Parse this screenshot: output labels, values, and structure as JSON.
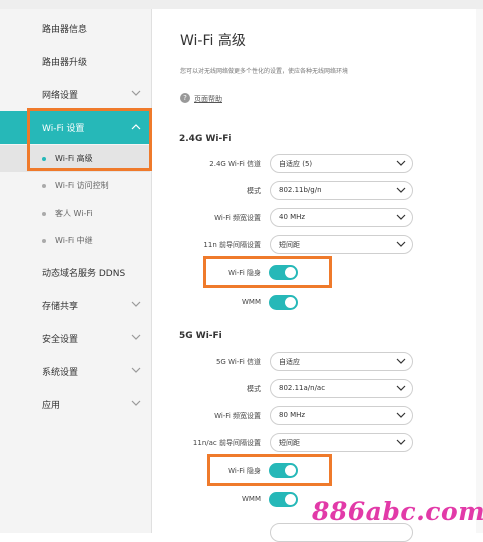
{
  "sidebar": {
    "items": [
      {
        "label": "路由器信息"
      },
      {
        "label": "路由器升级"
      },
      {
        "label": "网络设置"
      },
      {
        "label": "Wi-Fi 设置"
      },
      {
        "label": "动态域名服务 DDNS"
      },
      {
        "label": "存储共享"
      },
      {
        "label": "安全设置"
      },
      {
        "label": "系统设置"
      },
      {
        "label": "应用"
      }
    ],
    "subitems": [
      {
        "label": "Wi-Fi 高级"
      },
      {
        "label": "Wi-Fi 访问控制"
      },
      {
        "label": "客人 Wi-Fi"
      },
      {
        "label": "Wi-Fi 中继"
      }
    ]
  },
  "main": {
    "title": "Wi-Fi 高级",
    "description": "您可以对无线网络做更多个性化的设置，使应各种无线网络环境",
    "help": "页面帮助",
    "band24": {
      "heading": "2.4G Wi-Fi",
      "channel": {
        "label": "2.4G Wi-Fi 信道",
        "value": "自适应 (5)"
      },
      "mode": {
        "label": "模式",
        "value": "802.11b/g/n"
      },
      "bandwidth": {
        "label": "Wi-Fi 频宽设置",
        "value": "40 MHz"
      },
      "guard": {
        "label": "11n 前导间隔设置",
        "value": "短间距"
      },
      "hide": {
        "label": "Wi-Fi 隐身",
        "on": true
      },
      "wmm": {
        "label": "WMM",
        "on": true
      }
    },
    "band5": {
      "heading": "5G Wi-Fi",
      "channel": {
        "label": "5G Wi-Fi 信道",
        "value": "自适应"
      },
      "mode": {
        "label": "模式",
        "value": "802.11a/n/ac"
      },
      "bandwidth": {
        "label": "Wi-Fi 频宽设置",
        "value": "80 MHz"
      },
      "guard": {
        "label": "11n/ac 前导间隔设置",
        "value": "短间距"
      },
      "hide": {
        "label": "Wi-Fi 隐身",
        "on": true
      },
      "wmm": {
        "label": "WMM",
        "on": true
      }
    }
  },
  "watermark": "886abc.com",
  "colors": {
    "accent": "#26b8b8",
    "highlight": "#ef7a2b",
    "watermark": "#e23aa8"
  }
}
